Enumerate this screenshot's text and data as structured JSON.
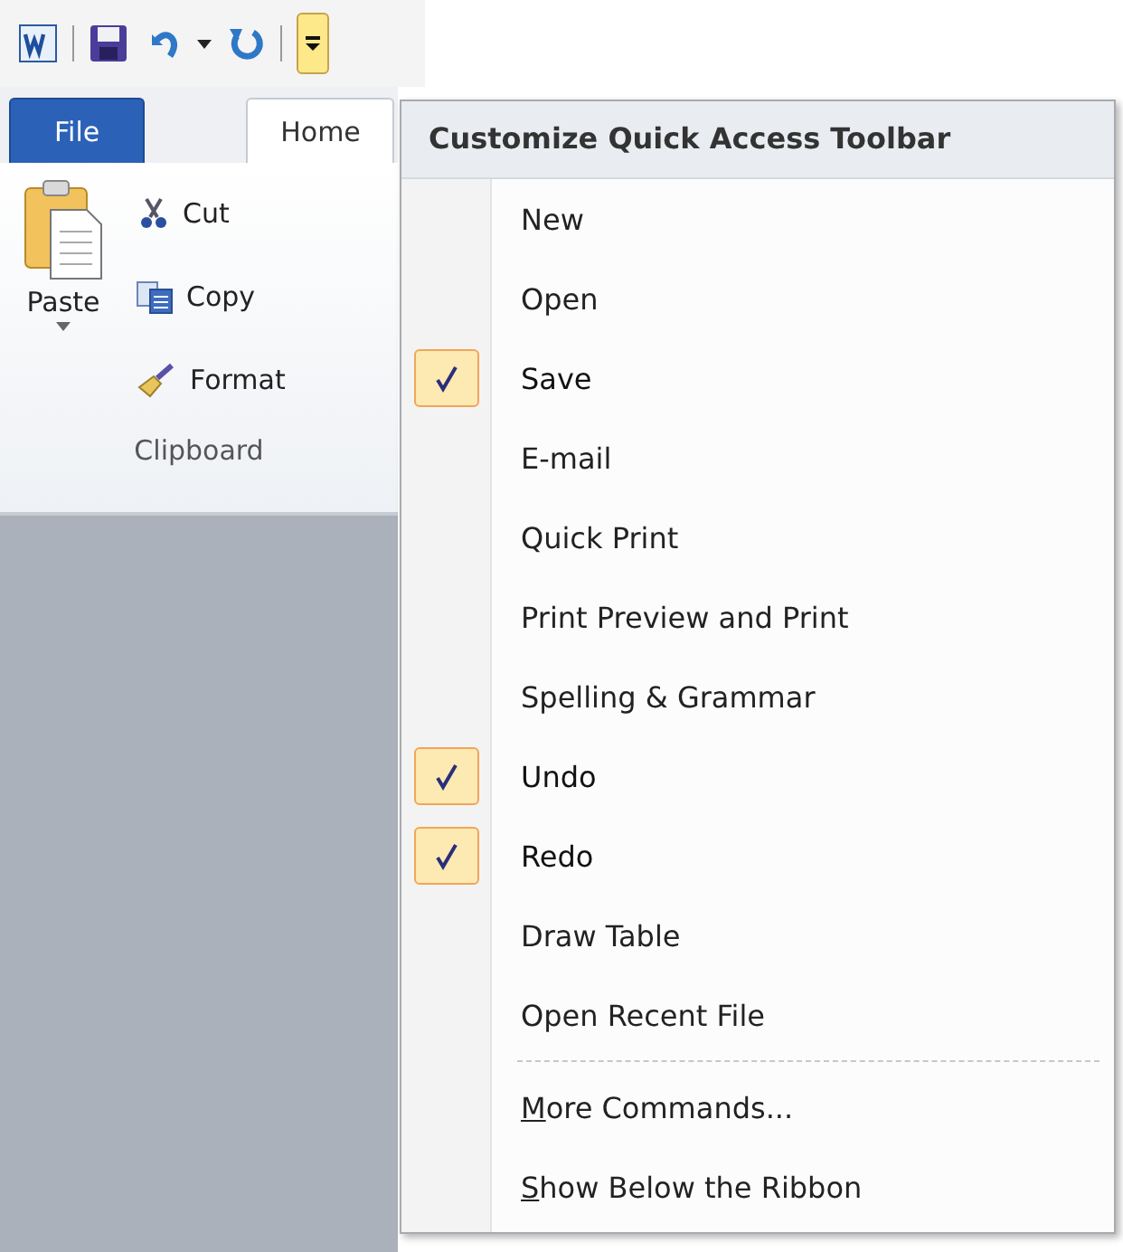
{
  "quick_access_toolbar": {
    "customize_selected": true
  },
  "tabs": [
    {
      "label": "File",
      "kind": "backstage",
      "selected": false
    },
    {
      "label": "Home",
      "kind": "tab",
      "selected": true
    }
  ],
  "clipboard": {
    "paste": "Paste",
    "commands": [
      "Cut",
      "Copy",
      "Format"
    ],
    "group_label": "Clipboard"
  },
  "menu": {
    "title": "Customize Quick Access Toolbar",
    "items": [
      {
        "label": "New",
        "checked": false
      },
      {
        "label": "Open",
        "checked": false
      },
      {
        "label": "Save",
        "checked": true
      },
      {
        "label": "E-mail",
        "checked": false
      },
      {
        "label": "Quick Print",
        "checked": false
      },
      {
        "label": "Print Preview and Print",
        "checked": false
      },
      {
        "label": "Spelling & Grammar",
        "checked": false
      },
      {
        "label": "Undo",
        "checked": true
      },
      {
        "label": "Redo",
        "checked": true
      },
      {
        "label": "Draw Table",
        "checked": false
      },
      {
        "label": "Open Recent File",
        "checked": false
      }
    ],
    "footer": [
      {
        "mnemonic": "M",
        "rest": "ore Commands..."
      },
      {
        "mnemonic": "S",
        "rest": "how Below the Ribbon"
      }
    ]
  }
}
